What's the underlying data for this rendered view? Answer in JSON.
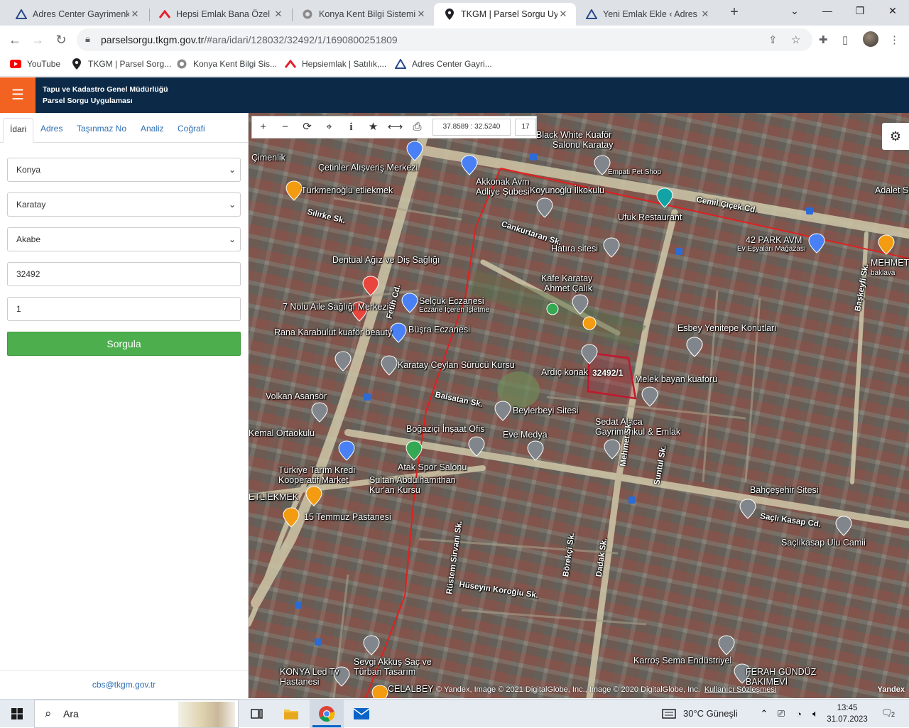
{
  "browser": {
    "tabs": [
      {
        "title": "Adres Center Gayrimenku",
        "icon": "triangle-logo-icon",
        "active": false
      },
      {
        "title": "Hepsi Emlak Bana Özel",
        "icon": "hepsiemlak-logo-icon",
        "active": false
      },
      {
        "title": "Konya Kent Bilgi Sistemi",
        "icon": "konya-logo-icon",
        "active": false
      },
      {
        "title": "TKGM | Parsel Sorgu Uygu",
        "icon": "location-pin-icon",
        "active": true
      },
      {
        "title": "Yeni Emlak Ekle ‹ Adres Ce",
        "icon": "triangle-logo-icon",
        "active": false
      }
    ],
    "url_host": "parselsorgu.tkgm.gov.tr",
    "url_path": "/#ara/idari/128032/32492/1/1690800251809",
    "bookmarks": [
      {
        "label": "YouTube",
        "icon": "youtube-icon"
      },
      {
        "label": "TKGM | Parsel Sorg...",
        "icon": "location-pin-icon"
      },
      {
        "label": "Konya Kent Bilgi Sis...",
        "icon": "konya-logo-icon"
      },
      {
        "label": "Hepsiemlak | Satılık,...",
        "icon": "hepsiemlak-logo-icon"
      },
      {
        "label": "Adres Center Gayri...",
        "icon": "triangle-logo-icon"
      }
    ]
  },
  "app": {
    "title_line1": "Tapu ve Kadastro Genel Müdürlüğü",
    "title_line2": "Parsel Sorgu Uygulaması",
    "brand_color": "#0c2a47",
    "accent_color": "#f26322"
  },
  "panel": {
    "tabs": [
      "İdari",
      "Adres",
      "Taşınmaz No",
      "Analiz",
      "Coğrafi"
    ],
    "province": "Konya",
    "district": "Karatay",
    "neighborhood": "Akabe",
    "block_no": "32492",
    "parcel_no": "1",
    "query_label": "Sorgula",
    "query_color": "#4cae4c",
    "footer_email": "cbs@tkgm.gov.tr"
  },
  "map": {
    "coordinates": "37.8589 : 32.5240",
    "zoom": "17",
    "parcel_label": "32492/1",
    "copyright": "© Yandex, Image © 2021 DigitalGlobe, Inc., Image © 2020 DigitalGlobe, Inc.",
    "terms": "Kullanıcı Sözleşmesi",
    "provider": "Yandex",
    "labels": [
      "Black White Kuaför",
      "Salonu Karatay",
      "Çimenlik",
      "Çetinler Alışveriş Merkezi",
      "Türkmenoğlu etliekmek",
      "Akkonak Avm",
      "Adliye Şubesi",
      "Koyunoğlu İlkokulu",
      "Empati Pet Shop",
      "Cemil Çiçek Cd.",
      "Adalet Sitesi",
      "Ufuk Restaurant",
      "42 PARK AVM",
      "Ev Eşyaları Mağazası",
      "MEHMET",
      "baklava",
      "Hatıra sitesi",
      "Dentual Ağız ve Diş Sağlığı",
      "Kafe Karatay",
      "Ahmet Çalık",
      "Selçuk Eczanesi",
      "Eczane İçeren İşletme",
      "7 Nolu Aile Sağlığı Merkezi",
      "Büşra Eczanesi",
      "Rana Karabulut kuaför beauty",
      "Esbey Yenitepe Konutları",
      "Karatay Ceylan Sürücü Kursu",
      "Ardıç konak",
      "Melek bayan kuaförü",
      "Volkan Asansör",
      "Beylerbeyi Sitesi",
      "Sedat Alaca Gayrimenkul & Emlak",
      "Boğaziçi İnşaat Ofis",
      "Eve Medya",
      "Kemal Ortaokulu",
      "Atak Spor Salonu",
      "Türkiye Tarım Kredi Kooperatif Market",
      "Sultan Abdulhamithan Kur'an Kursu",
      "ETLİEKMEK",
      "15 Temmuz Pastanesi",
      "Bahçeşehir Sitesi",
      "Saçlıkasap Ulu Camii",
      "Saçlı Kasap Cd.",
      "Hüseyin Koroğlu Sk.",
      "Karroş Sema Endüstriyel",
      "FERAH GÜNDÜZ BAKIMEVİ",
      "Sevgi Akkuş Saç ve Türban Tasarım",
      "KONYA Led Tv Hastanesi",
      "CELALBEY",
      "Fetih Cd.",
      "Rüstem Sirvani Sk.",
      "Balsatan Sk.",
      "Cankurtaran Sk.",
      "Sılırke Sk.",
      "Dadak Sk.",
      "Börekçi Sk.",
      "Mehmet Sk.",
      "Suntul Sk.",
      "Başkeyfi Sk."
    ]
  },
  "taskbar": {
    "search_placeholder": "Ara",
    "weather": "30°C Güneşli",
    "time": "13:45",
    "date": "31.07.2023",
    "notifications": "2"
  }
}
